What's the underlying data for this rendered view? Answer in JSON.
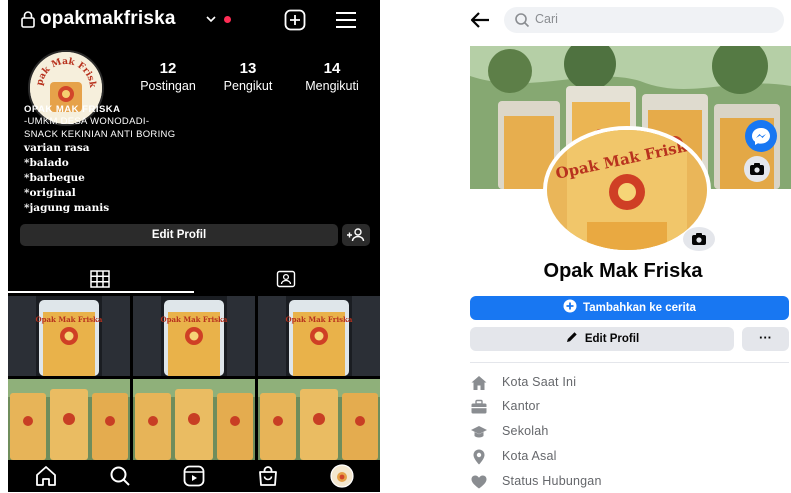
{
  "instagram": {
    "username": "opakmakfriska",
    "avatar_text": "Opak Mak Friska",
    "stats": [
      {
        "value": "12",
        "label": "Postingan"
      },
      {
        "value": "13",
        "label": "Pengikut"
      },
      {
        "value": "14",
        "label": "Mengikuti"
      }
    ],
    "bio": {
      "name": "OPAK MAK FRISKA",
      "lines": [
        "-UMKM DESA WONODADI-",
        "SNACK KEKINIAN ANTI BORING"
      ],
      "flavors": [
        "varian rasa",
        "*balado",
        "*barbeque",
        "*original",
        "*jagung manis"
      ]
    },
    "edit_profile_label": "Edit Profil",
    "post_label": "Opak Mak Friska",
    "icons": [
      "lock-icon",
      "chevron-down-icon",
      "new-post-icon",
      "menu-icon",
      "add-person-icon",
      "grid-icon",
      "tagged-icon",
      "home-icon",
      "search-icon",
      "reels-icon",
      "shop-icon",
      "profile-avatar-icon"
    ]
  },
  "facebook": {
    "search_placeholder": "Cari",
    "page_name": "Opak Mak Friska",
    "add_story_label": "Tambahkan ke cerita",
    "edit_profile_label": "Edit Profil",
    "more_label": "···",
    "info_items": [
      {
        "label": "Kota Saat Ini",
        "icon": "home-icon"
      },
      {
        "label": "Kantor",
        "icon": "briefcase-icon"
      },
      {
        "label": "Sekolah",
        "icon": "graduation-cap-icon"
      },
      {
        "label": "Kota Asal",
        "icon": "location-pin-icon"
      },
      {
        "label": "Status Hubungan",
        "icon": "heart-icon"
      }
    ],
    "colors": {
      "primary": "#1877f2",
      "button_gray": "#e4e6eb",
      "muted_text": "#65676b"
    }
  }
}
